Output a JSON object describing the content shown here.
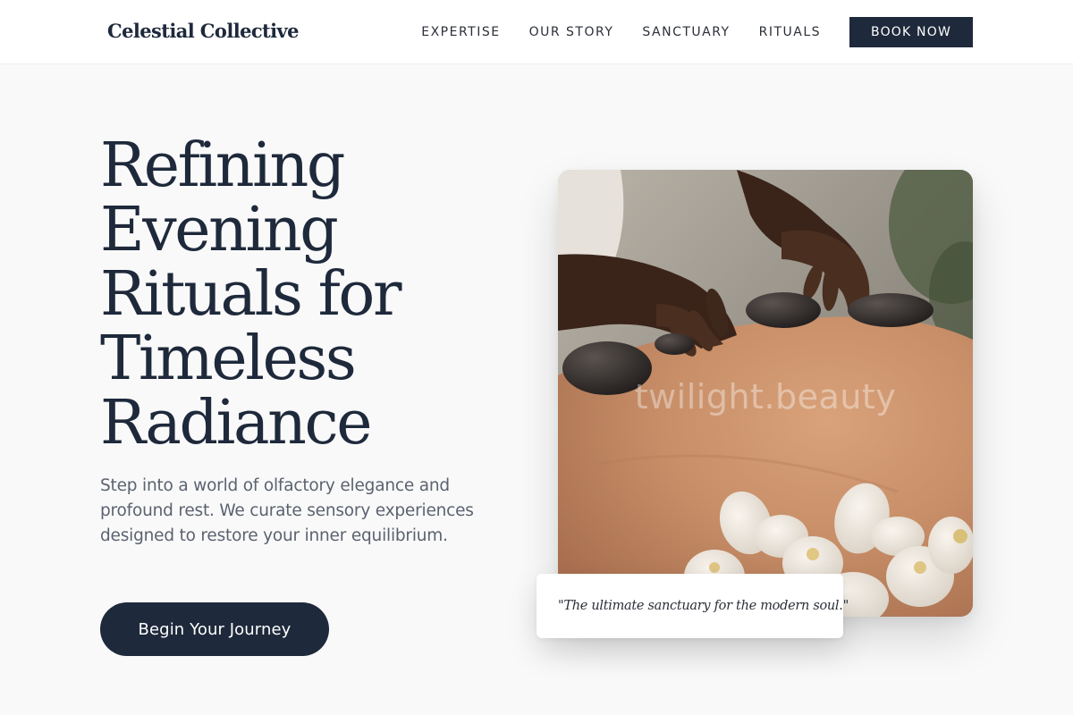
{
  "header": {
    "brand": "Celestial Collective",
    "nav": [
      {
        "label": "EXPERTISE"
      },
      {
        "label": "OUR STORY"
      },
      {
        "label": "SANCTUARY"
      },
      {
        "label": "RITUALS"
      }
    ],
    "cta_label": "BOOK NOW"
  },
  "hero": {
    "title_lines": [
      "Refining",
      "Evening",
      "Rituals for",
      "Timeless",
      "Radiance"
    ],
    "subtitle": "Step into a world of olfactory elegance and profound rest. We curate sensory experiences designed to restore your inner equilibrium.",
    "cta_label": "Begin Your Journey"
  },
  "image": {
    "watermark": "twilight.beauty",
    "quote": "\"The ultimate sanctuary for the modern soul.\""
  },
  "colors": {
    "primary": "#1e293b",
    "background": "#f9f9f9",
    "muted_text": "#5b6270"
  }
}
